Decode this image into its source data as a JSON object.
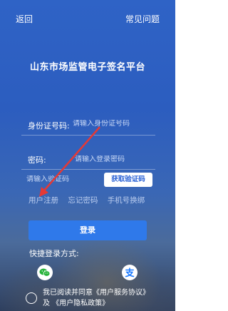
{
  "header": {
    "back": "返回",
    "help": "常见问题"
  },
  "title": "山东市场监管电子签名平台",
  "form": {
    "id_label": "身份证号码:",
    "id_placeholder": "请输入身份证号码",
    "pwd_label": "密码:",
    "pwd_placeholder": "请输入登录密码",
    "code_placeholder": "请输入验证码",
    "get_code": "获取验证码"
  },
  "links": {
    "register": "用户注册",
    "forgot": "忘记密码",
    "change_phone": "手机号换绑"
  },
  "login_button": "登录",
  "quick_login": "快捷登录方式:",
  "agreement": {
    "prefix": "我已阅读并同意",
    "service": "《用户服务协议》",
    "and": "及",
    "privacy": "《用户隐私政策》"
  },
  "colors": {
    "accent": "#2f79ea",
    "arrow": "#e53935"
  },
  "icons": {
    "wechat": "wechat-icon",
    "alipay": "alipay-icon"
  }
}
